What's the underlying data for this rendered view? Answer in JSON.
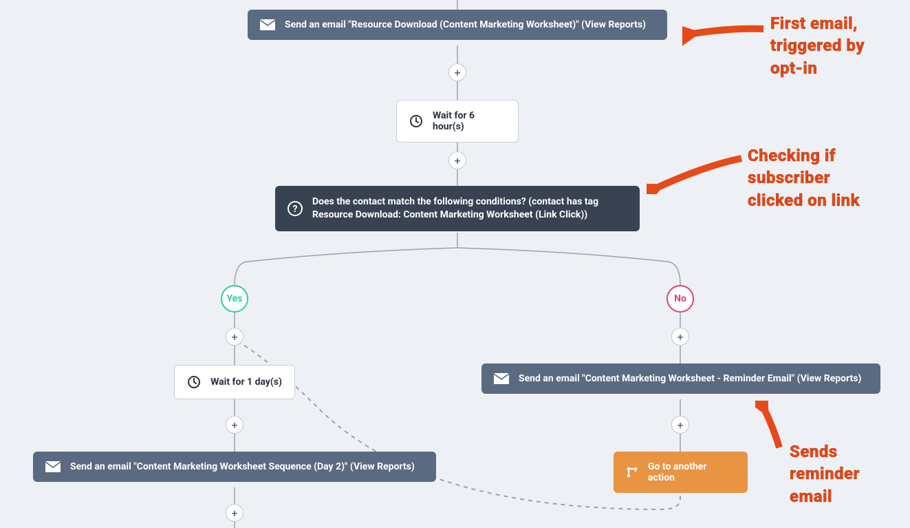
{
  "nodes": {
    "email1_label": "Send an email \"Resource Download (Content Marketing Worksheet)\" (View Reports)",
    "wait1_label": "Wait for 6 hour(s)",
    "condition_label": "Does the contact match the following conditions? (contact has tag Resource Download: Content Marketing Worksheet (Link Click))",
    "wait2_label": "Wait for 1 day(s)",
    "email2_label": "Send an email \"Content Marketing Worksheet Sequence (Day 2)\" (View Reports)",
    "email3_label": "Send an email \"Content Marketing Worksheet - Reminder Email\" (View Reports)",
    "goto_label": "Go to another action"
  },
  "branches": {
    "yes": "Yes",
    "no": "No"
  },
  "annotations": {
    "a1": "First email, triggered by opt-in",
    "a2": "Checking if subscriber clicked on link",
    "a3": "Sends reminder email"
  },
  "plus_glyph": "+"
}
